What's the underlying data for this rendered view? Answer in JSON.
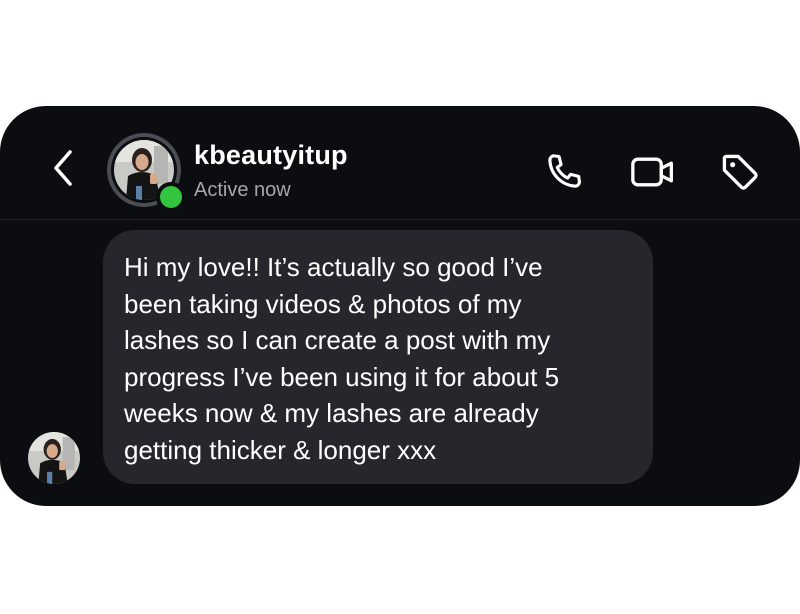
{
  "header": {
    "username": "kbeautyitup",
    "status": "Active now",
    "icons": [
      "back-chevron-icon",
      "phone-icon",
      "video-camera-icon",
      "tag-icon"
    ]
  },
  "message": {
    "text": "Hi my love!! It’s actually so good I’ve\nbeen taking videos & photos of my\nlashes so I can create a post with my\nprogress I’ve been using it for about 5\nweeks now & my lashes are already\ngetting thicker & longer xxx"
  },
  "colors": {
    "background": "#0c0d10",
    "bubble": "#25272d",
    "active_dot": "#34c540",
    "secondary_text": "#a3a7ae"
  }
}
